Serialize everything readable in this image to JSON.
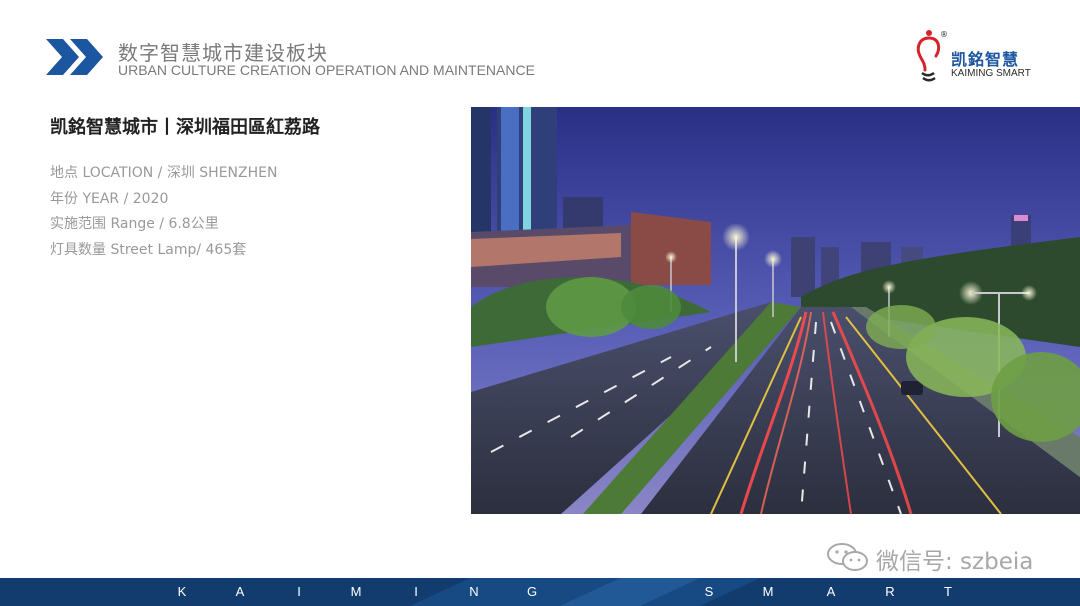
{
  "header": {
    "title_cn": "数字智慧城市建设板块",
    "title_en": "URBAN CULTURE CREATION OPERATION AND MAINTENANCE",
    "accent_color": "#1d56a0"
  },
  "brand": {
    "name_cn": "凯銘智慧",
    "name_en": "KAIMING SMART",
    "trademark": "®",
    "mark_color": "#d6232a"
  },
  "project": {
    "title": "凯銘智慧城市丨深圳福田區紅荔路",
    "details": [
      "地点 LOCATION  /  深圳 SHENZHEN",
      "年份 YEAR  /  2020",
      "实施范围 Range / 6.8公里",
      "灯具数量 Street Lamp/  465套"
    ]
  },
  "photo": {
    "subject": "night street view with street lamps"
  },
  "watermark": {
    "icon": "wechat-icon",
    "text": "微信号: szbeia"
  },
  "footer": {
    "background": "#123c6e",
    "letters": [
      "K",
      "A",
      "I",
      "M",
      "I",
      "N",
      "G",
      "S",
      "M",
      "A",
      "R",
      "T"
    ]
  }
}
